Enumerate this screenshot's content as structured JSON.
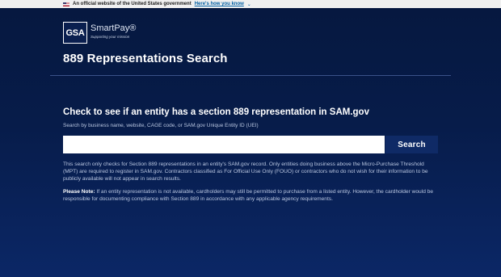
{
  "gov_banner": {
    "text": "An official website of the United States government",
    "link": "Here's how you know"
  },
  "header": {
    "logo_text": "GSA",
    "brand_name": "SmartPay®",
    "brand_tagline": "Supporting your mission",
    "page_title": "889 Representations Search"
  },
  "search": {
    "heading": "Check to see if an entity has a section 889 representation in SAM.gov",
    "subheading": "Search by business name, website, CAGE code, or SAM.gov Unique Entity ID (UEI)",
    "input_value": "",
    "placeholder": "",
    "button_label": "Search"
  },
  "disclaimer": "This search only checks for Section 889 representations in an entity's SAM.gov record. Only entities doing business above the Micro-Purchase Threshold (MPT) are required to register in SAM.gov. Contractors classified as For Official Use Only (FOUO) or contractors who do not wish for their information to be publicly available will not appear in search results.",
  "note": {
    "label": "Please Note:",
    "text": " If an entity representation is not available, cardholders may still be permitted to purchase from a listed entity. However, the cardholder would be responsible for documenting compliance with Section 889 in accordance with any applicable agency requirements."
  },
  "colors": {
    "background": "#071c4a",
    "button": "#0f2a66",
    "link": "#005ea2"
  }
}
